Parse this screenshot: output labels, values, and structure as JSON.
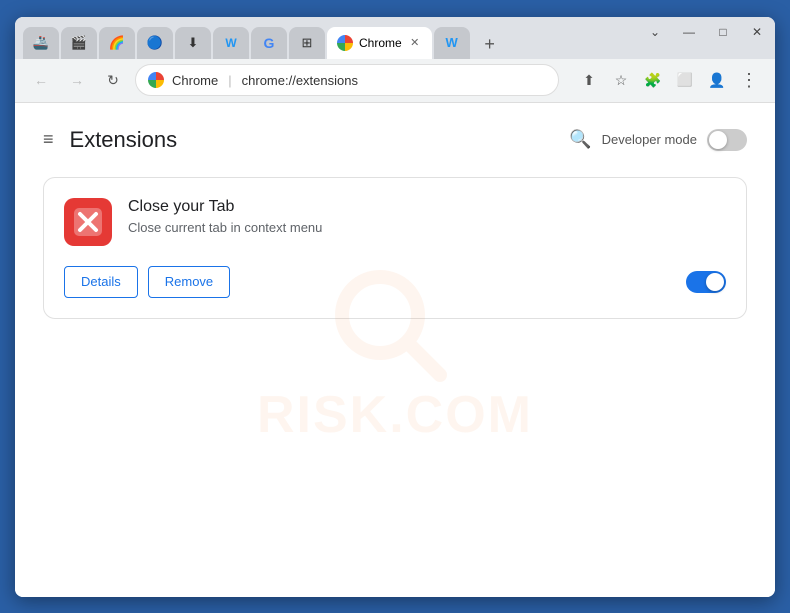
{
  "browser": {
    "title": "Extensions",
    "window_controls": {
      "chevron_label": "⌄",
      "minimize_label": "—",
      "maximize_label": "□",
      "close_label": "✕"
    },
    "tabs": [
      {
        "id": "t1",
        "icon": "🚢",
        "label": "",
        "active": false
      },
      {
        "id": "t2",
        "icon": "🎬",
        "label": "",
        "active": false
      },
      {
        "id": "t3",
        "icon": "🌈",
        "label": "",
        "active": false
      },
      {
        "id": "t4",
        "icon": "🔵",
        "label": "",
        "active": false
      },
      {
        "id": "t5",
        "icon": "⬇",
        "label": "",
        "active": false
      },
      {
        "id": "t6",
        "icon": "W",
        "label": "",
        "active": false
      },
      {
        "id": "t7",
        "icon": "G",
        "label": "",
        "active": false
      },
      {
        "id": "t8",
        "icon": "⊞",
        "label": "",
        "active": false
      },
      {
        "id": "t9",
        "icon": "",
        "label": "Chrome",
        "active": true
      },
      {
        "id": "t10",
        "icon": "W",
        "label": "",
        "active": false
      }
    ],
    "new_tab_label": "+",
    "nav": {
      "back_label": "←",
      "forward_label": "→",
      "reload_label": "↻",
      "brand_label": "Chrome",
      "address": "chrome://extensions",
      "share_label": "⬆",
      "bookmark_label": "☆",
      "extensions_label": "🧩",
      "split_label": "⬜",
      "profile_label": "👤",
      "menu_label": "⋮"
    }
  },
  "page": {
    "hamburger_label": "≡",
    "title": "Extensions",
    "search_icon_label": "🔍",
    "dev_mode_label": "Developer mode",
    "extension": {
      "name": "Close your Tab",
      "description": "Close current tab in context menu",
      "details_label": "Details",
      "remove_label": "Remove",
      "enabled": true
    }
  },
  "watermark": {
    "text": "RISK.COM"
  }
}
